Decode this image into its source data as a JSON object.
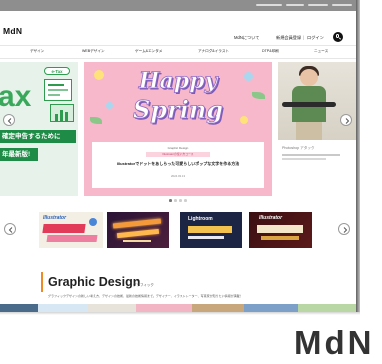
{
  "site": {
    "logo": "MdN"
  },
  "header": {
    "about": "MdNについて",
    "register": "新規会員登録",
    "separator": "|",
    "login": "ログイン",
    "search_icon": "search-icon"
  },
  "nav": {
    "items": [
      "デザイン",
      "WEBデザイン",
      "ゲーム&エンタメ",
      "アナログ&イラスト",
      "DTP&印刷",
      "ニュース"
    ]
  },
  "hero": {
    "left_slide": {
      "badge": "e-Tax",
      "big_text": "ax",
      "line1": "確定申告するために",
      "line2": "年最新版!"
    },
    "center_slide": {
      "headline_1": "Happy",
      "headline_2": "Spring",
      "category": "Graphic Design",
      "tag": "Illustratorの使い方コース",
      "title": "Illustratorでドットをあしらった可愛らしいポップな文字を作る方法",
      "date": "2024.03.13"
    },
    "right_slide": {
      "caption": "Photoshop アタック"
    },
    "prev_icon": "chevron-left-icon",
    "next_icon": "chevron-right-icon"
  },
  "banners": [
    {
      "title": "Illustrator"
    },
    {},
    {
      "title": "Lightroom"
    },
    {
      "title": "Illustrator"
    }
  ],
  "section": {
    "heading": "Graphic Design",
    "sub_label": "グラフィック",
    "description": "グラフィックデザインの新しい考え方、デザインの技術、最新の技術情報まで。デザイナー、イラストレーター、写真家が知りたい情報が満載！"
  },
  "footer_logo": "MdN",
  "colors": {
    "accent": "#f08a24",
    "hero_pink": "#f6b8ca",
    "headline_purple": "#8e6cc8",
    "tax_green": "#1e8b46",
    "utility_bar": "#8e8e8e"
  },
  "icons": [
    "search-icon",
    "chevron-left-icon",
    "chevron-right-icon"
  ]
}
